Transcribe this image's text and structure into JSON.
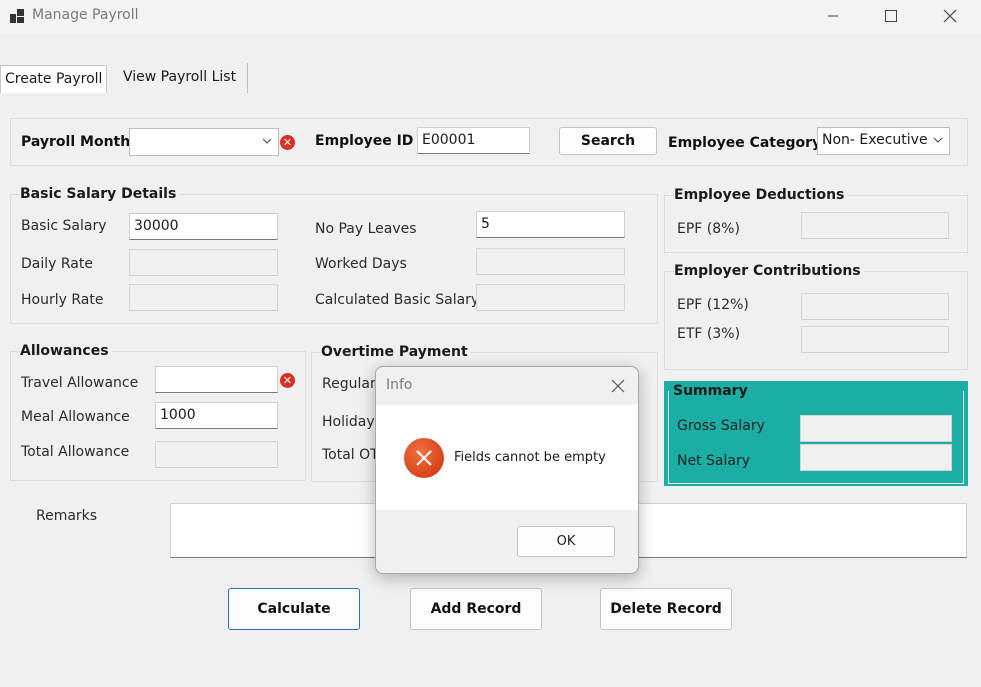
{
  "window": {
    "title": "Manage Payroll",
    "icons": {
      "app": "app-icon",
      "minimize": "minimize-icon",
      "maximize": "maximize-icon",
      "close": "close-icon"
    }
  },
  "tabs": [
    {
      "label": "Create Payroll",
      "active": true
    },
    {
      "label": "View Payroll List",
      "active": false
    }
  ],
  "header_row": {
    "payroll_month_label": "Payroll Month",
    "payroll_month_value": "",
    "employee_id_label": "Employee ID",
    "employee_id_value": "E00001",
    "search_label": "Search",
    "employee_category_label": "Employee Category",
    "employee_category_value": "Non- Executive"
  },
  "basic_salary": {
    "title": "Basic Salary Details",
    "basic_salary_label": "Basic Salary",
    "basic_salary_value": "30000",
    "daily_rate_label": "Daily Rate",
    "daily_rate_value": "",
    "hourly_rate_label": "Hourly Rate",
    "hourly_rate_value": "",
    "no_pay_leaves_label": "No Pay Leaves",
    "no_pay_leaves_value": "5",
    "worked_days_label": "Worked Days",
    "worked_days_value": "",
    "calculated_basic_label": "Calculated Basic Salary",
    "calculated_basic_value": ""
  },
  "deductions": {
    "title": "Employee Deductions",
    "epf_label": "EPF (8%)",
    "epf_value": ""
  },
  "contributions": {
    "title": "Employer Contributions",
    "epf_label": "EPF (12%)",
    "epf_value": "",
    "etf_label": "ETF (3%)",
    "etf_value": ""
  },
  "allowances": {
    "title": "Allowances",
    "travel_label": "Travel Allowance",
    "travel_value": "",
    "meal_label": "Meal Allowance",
    "meal_value": "1000",
    "total_label": "Total Allowance",
    "total_value": ""
  },
  "overtime": {
    "title": "Overtime Payment",
    "regular_label": "Regular",
    "holiday_label": "Holiday",
    "total_label": "Total OT"
  },
  "summary": {
    "title": "Summary",
    "gross_label": "Gross Salary",
    "gross_value": "",
    "net_label": "Net Salary",
    "net_value": "",
    "color": "#1aaea4"
  },
  "remarks": {
    "label": "Remarks",
    "value": ""
  },
  "actions": {
    "calculate": "Calculate",
    "add_record": "Add Record",
    "delete_record": "Delete Record"
  },
  "dialog": {
    "title": "Info",
    "message": "Fields cannot be empty",
    "ok_label": "OK",
    "icon": "error-icon"
  },
  "colors": {
    "error_icon": "#d93025",
    "dialog_icon": "#e0501f",
    "default_button_border": "#2f6fb2"
  }
}
